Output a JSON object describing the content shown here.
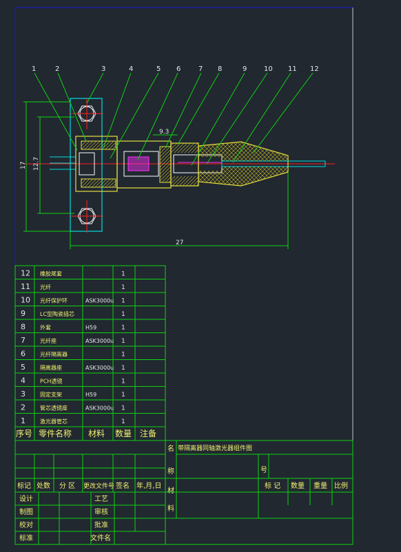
{
  "callouts": [
    "1",
    "2",
    "3",
    "4",
    "5",
    "6",
    "7",
    "8",
    "9",
    "10",
    "11",
    "12"
  ],
  "dimensions": {
    "d93": "9.3",
    "d127": "12.7",
    "d17": "17",
    "d27": "27"
  },
  "parts_table": {
    "rows": [
      {
        "no": "12",
        "name": "橡胶尾套",
        "mat": "",
        "qty": "1",
        "note": ""
      },
      {
        "no": "11",
        "name": "光纤",
        "mat": "",
        "qty": "1",
        "note": ""
      },
      {
        "no": "10",
        "name": "光纤保护环",
        "mat": "ASK3000u",
        "qty": "1",
        "note": ""
      },
      {
        "no": "9",
        "name": "LC型陶瓷插芯",
        "mat": "",
        "qty": "1",
        "note": ""
      },
      {
        "no": "8",
        "name": "外套",
        "mat": "H59",
        "qty": "1",
        "note": ""
      },
      {
        "no": "7",
        "name": "光纤座",
        "mat": "ASK3000u",
        "qty": "1",
        "note": ""
      },
      {
        "no": "6",
        "name": "光纤隔离器",
        "mat": "",
        "qty": "1",
        "note": ""
      },
      {
        "no": "5",
        "name": "隔离器座",
        "mat": "ASK3000u",
        "qty": "1",
        "note": ""
      },
      {
        "no": "4",
        "name": "PCH透镜",
        "mat": "",
        "qty": "1",
        "note": ""
      },
      {
        "no": "3",
        "name": "固定支架",
        "mat": "H59",
        "qty": "1",
        "note": ""
      },
      {
        "no": "2",
        "name": "管芯透镜座",
        "mat": "ASK3000u",
        "qty": "1",
        "note": ""
      },
      {
        "no": "1",
        "name": "激光器管芯",
        "mat": "",
        "qty": "1",
        "note": ""
      }
    ],
    "header": {
      "no": "序号",
      "name": "零件名称",
      "mat": "材料",
      "qty": "数量",
      "note": "注备"
    }
  },
  "title_block": {
    "name_char": "名",
    "title": "带隔离器同轴激光器组件图",
    "cheng": "称",
    "hao": "号",
    "cai": "材",
    "liao": "料",
    "rev_row": {
      "c1": "标记",
      "c2": "处数",
      "c3": "分 区",
      "c4": "更改文件号",
      "c5": "签名",
      "c6": "年,月,日"
    },
    "right_row": {
      "c1": "标 记",
      "c2": "数量",
      "c3": "重量",
      "c4": "比例"
    },
    "sig": {
      "design": "设计",
      "draw": "制图",
      "check": "校对",
      "std": "标准",
      "proc": "工艺",
      "review": "审核",
      "approve": "批准",
      "filename": "文件名"
    }
  },
  "colors": {
    "bg": "#212830",
    "line": "#10d410",
    "cyan": "#00e0e0",
    "red": "#ff2020",
    "yellow": "#e8e040",
    "magenta": "#ff30ff",
    "border": "#1818d0"
  }
}
